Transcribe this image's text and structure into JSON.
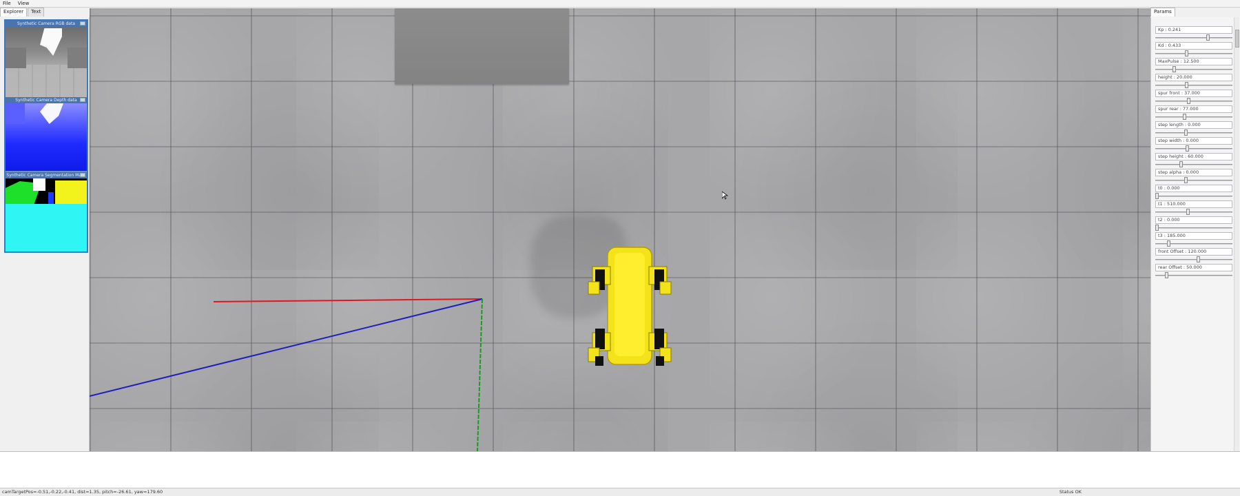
{
  "menu": [
    "File",
    "View"
  ],
  "left_tabs": [
    "Explorer",
    "Text"
  ],
  "right_tabs": [
    "Params"
  ],
  "cameras": [
    {
      "title": "Synthetic Camera RGB data"
    },
    {
      "title": "Synthetic Camera Depth data"
    },
    {
      "title": "Synthetic Camera Segmentation Mask"
    }
  ],
  "params": [
    {
      "label": "Kp : 0.241",
      "value": 0.74
    },
    {
      "label": "Kd : 0.433",
      "value": 0.43
    },
    {
      "label": "MaxPulse : 12.500",
      "value": 0.25
    },
    {
      "label": "height : 20.000",
      "value": 0.43
    },
    {
      "label": "spur front : 37.000",
      "value": 0.46
    },
    {
      "label": "spur rear : 77.000",
      "value": 0.4
    },
    {
      "label": "step length : 0.000",
      "value": 0.42
    },
    {
      "label": "step width : 0.000",
      "value": 0.44
    },
    {
      "label": "step height : 60.000",
      "value": 0.35
    },
    {
      "label": "step alpha : 0.000",
      "value": 0.42
    },
    {
      "label": "t0 : 0.000",
      "value": 0.0
    },
    {
      "label": "t1 : 510.000",
      "value": 0.45
    },
    {
      "label": "t2 : 0.000",
      "value": 0.0
    },
    {
      "label": "t3 : 185.000",
      "value": 0.17
    },
    {
      "label": "front Offset : 120.000",
      "value": 0.6
    },
    {
      "label": "rear Offset : 50.000",
      "value": 0.14
    }
  ],
  "status": {
    "left": "camTargetPos=-0.51,-0.22,-0.41, dist=1.35, pitch=-26.61, yaw=179.60",
    "right": "Status OK"
  },
  "colors": {
    "robot": "#f4e21a",
    "axis_x": "#e0171d",
    "axis_y": "#1a9b1a",
    "axis_z": "#1f1fbf"
  }
}
